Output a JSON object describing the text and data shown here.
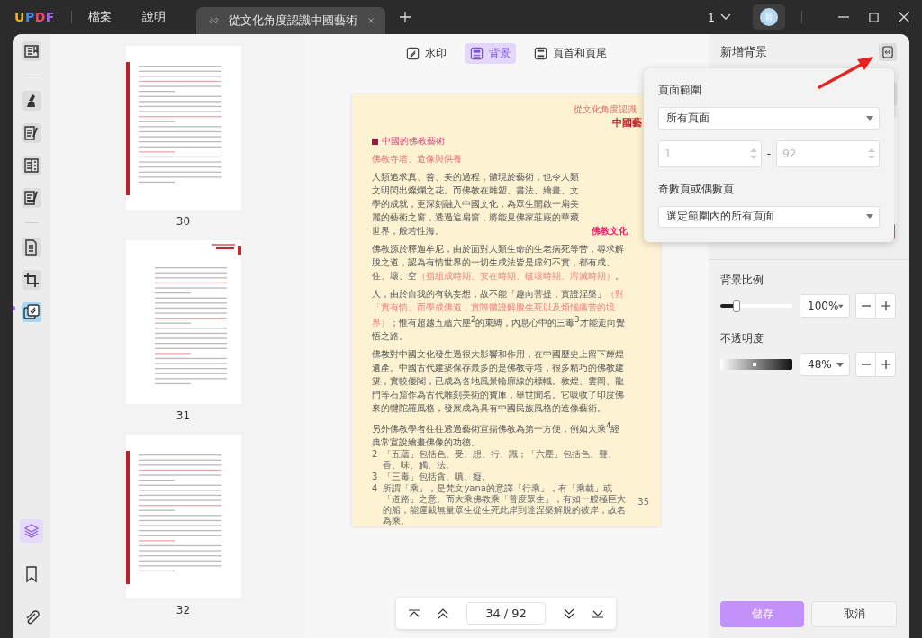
{
  "app": {
    "logo": "UPDF",
    "menu": [
      "檔案",
      "說明"
    ],
    "tab": {
      "title": "從文化角度認識中國藝術"
    },
    "page_menu": "1",
    "avatar": "音"
  },
  "tools": [
    {
      "selected": false
    },
    {
      "selected": false
    },
    {
      "selected": false
    },
    {
      "selected": false
    },
    {
      "selected": false
    },
    {
      "selected": false
    },
    {
      "selected": false
    },
    {
      "selected": true
    }
  ],
  "bottom_tools": [
    {
      "selected": true
    },
    {
      "selected": false
    },
    {
      "selected": false
    }
  ],
  "thumbnails": [
    {
      "page": "30",
      "selected": false
    },
    {
      "page": "31",
      "selected": false
    },
    {
      "page": "32",
      "selected": false
    }
  ],
  "modes": [
    {
      "label": "水印",
      "selected": false
    },
    {
      "label": "背景",
      "selected": true
    },
    {
      "label": "頁首和頁尾",
      "selected": false
    }
  ],
  "document": {
    "header": [
      "從文化角度認識",
      "中國藝"
    ],
    "section_title": "中國的佛教藝術",
    "subtitle": "佛教寺塔、造像與供養",
    "paragraphs": [
      {
        "segments": [
          {
            "text": "人類追求真、善、美的過程，體現於藝術，也令人類文明閃出燦爛之花。而佛教在雕塑、書法、繪畫、文學的成就，更深刻融入中國文化，為眾生開啟一扇美麗的藝術之窗，透過這扇窗，將能見佛家莊嚴的華藏世界，般若性海。",
            "kind": "plain"
          }
        ],
        "tag": "佛教文化"
      },
      {
        "segments": [
          {
            "text": "佛教源於釋迦牟尼，由於面對人類生命的生老病死等苦，尋求解脫之道，認為有情世界的一切生成法皆是虛幻不實，都有成、住、壞、空",
            "kind": "plain"
          },
          {
            "text": "（指組成時期、安在時期、破壞時期、溶滅時期）",
            "kind": "red"
          },
          {
            "text": "。",
            "kind": "plain"
          }
        ]
      },
      {
        "segments": [
          {
            "text": "人，由於自我的有執妄想，故不能「趣向菩提，實證涅槃」",
            "kind": "plain"
          },
          {
            "text": "（對「實有情」而學成佛道，實際體證解脫生死以及煩惱痛苦的境界）",
            "kind": "red"
          },
          {
            "text": "；惟有超越五蘊六塵$^{2}$的束縛，內息心中的三毒$^{3}$才能走向覺悟之路。",
            "kind": "plain"
          }
        ]
      },
      {
        "segments": [
          {
            "text": "佛教對中國文化發生過很大影響和作用，在中國歷史上留下輝煌遺產。中國古代建築保存最多的是佛教寺塔，很多精巧的佛教建築，實較優閣，已成為各地風景輪廓線的標幟。敦煌、雲岡、龍門等石窟作為古代雕刻美術的寶庫，舉世聞名。它吸收了印度佛來的犍陀羅風格，發展成為具有中國民族風格的造像藝術。",
            "kind": "plain"
          }
        ]
      },
      {
        "segments": [
          {
            "text": "另外佛教學者往往透過藝術宣揚佛教為第一方便，例如大乘$^{4}$經典常宣說繪畫佛像的功德。",
            "kind": "plain"
          }
        ]
      }
    ],
    "footnotes": [
      {
        "mark": "2",
        "text": "「五蘊」包括色、受、想、行、識；「六塵」包括色、聲、香、味、觸、法。"
      },
      {
        "mark": "3",
        "text": "「三毒」包括貪、嗔、癡。"
      },
      {
        "mark": "4",
        "text": "所謂「乘」，是梵文yana的意譯「行乘」，有「乘載」或「道路」之意。而大乘佛教乘「普度眾生」，有如一艘極巨大的船，能運載無量眾生從生死此岸到達涅槃解脫的彼岸，故名為乘。"
      }
    ],
    "page_number": "35"
  },
  "navigator": {
    "position": "34 / 92"
  },
  "panel": {
    "title": "新增背景",
    "scale": {
      "label": "背景比例",
      "level": 0.22,
      "value": "100%"
    },
    "opacity": {
      "label": "不透明度",
      "level": 0.48,
      "value": "48%"
    },
    "buttons": [
      {
        "label": "儲存",
        "kind": "primary"
      },
      {
        "label": "取消",
        "kind": "secondary"
      }
    ]
  },
  "popup": {
    "range_label": "頁面範圍",
    "range_value": "所有頁面",
    "from": {
      "value": "1",
      "disabled": true
    },
    "separator": "-",
    "to": {
      "value": "92",
      "disabled": true
    },
    "parity_label": "奇數頁或偶數頁",
    "parity_value": "選定範圍內的所有頁面"
  }
}
